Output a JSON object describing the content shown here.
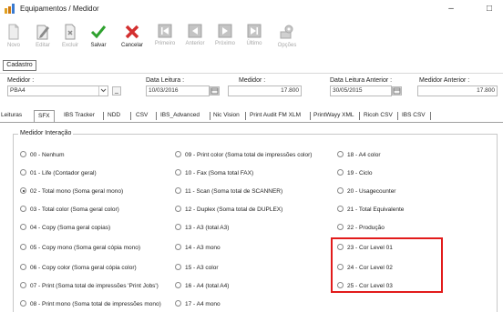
{
  "window": {
    "title": "Equipamentos / Medidor",
    "minimize": "–",
    "maximize": "□"
  },
  "toolbar": {
    "items": [
      {
        "label": "Novo",
        "icon": "new-doc-icon",
        "enabled": false
      },
      {
        "label": "Editar",
        "icon": "edit-icon",
        "enabled": false
      },
      {
        "label": "Excluir",
        "icon": "delete-icon",
        "enabled": false
      },
      {
        "label": "Salvar",
        "icon": "save-check-icon",
        "enabled": true
      },
      {
        "label": "Cancelar",
        "icon": "cancel-x-icon",
        "enabled": true
      },
      {
        "label": "Primeiro",
        "icon": "first-icon",
        "enabled": false
      },
      {
        "label": "Anterior",
        "icon": "previous-icon",
        "enabled": false
      },
      {
        "label": "Próximo",
        "icon": "next-icon",
        "enabled": false
      },
      {
        "label": "Último",
        "icon": "last-icon",
        "enabled": false
      },
      {
        "label": "Opções",
        "icon": "options-icon",
        "enabled": false
      }
    ],
    "colors": {
      "save": "#2ea12e",
      "cancel": "#d32f2f",
      "disabled": "#a8a8a8"
    }
  },
  "cadastro_tab": "Cadastro",
  "form": {
    "medidor_label": "Medidor :",
    "medidor_value": "PBA4",
    "data_leitura_label": "Data Leitura :",
    "data_leitura_value": "10/03/2016",
    "medidor2_label": "Medidor :",
    "medidor2_value": "17.800",
    "data_leitura_anterior_label": "Data Leitura Anterior :",
    "data_leitura_anterior_value": "30/05/2015",
    "medidor_anterior_label": "Medidor Anterior :",
    "medidor_anterior_value": "17.800"
  },
  "tabs": [
    "Leituras",
    "SFX",
    "IBS Tracker",
    "NDD",
    "CSV",
    "IBS_Advanced",
    "Nic Vision",
    "Print Audit FM XLM",
    "PrintWayy XML",
    "Ricoh CSV",
    "IBS CSV"
  ],
  "active_tab": "SFX",
  "group": {
    "title": "Medidor Interação",
    "col1": [
      "00 - Nenhum",
      "01 - Life (Contador geral)",
      "02 - Total mono (Soma geral mono)",
      "03 - Total color (Soma geral color)",
      "04 - Copy (Soma geral copias)",
      "05 - Copy mono (Soma geral cópia mono)",
      "06 - Copy color (Soma geral cópia color)",
      "07 - Print (Soma total de impressões 'Print Jobs')",
      "08 - Print mono (Soma total de impressões mono)"
    ],
    "col2": [
      "09 - Print color (Soma total de impressões color)",
      "10 - Fax (Soma total FAX)",
      "11 - Scan (Soma total de SCANNER)",
      "12 - Duplex (Soma total de DUPLEX)",
      "13 - A3 (total A3)",
      "14 - A3 mono",
      "15 - A3 color",
      "16 - A4 (total A4)",
      "17 - A4 mono"
    ],
    "col3": [
      "18 - A4 color",
      "19 - Ciclo",
      "20 - Usagecounter",
      "21 - Total Equivalente",
      "22 - Produção",
      "23 - Cor Level 01",
      "24 - Cor Level 02",
      "25 - Cor Level 03"
    ],
    "selected": "02 - Total mono (Soma geral mono)"
  },
  "highlight_color": "#e21b1b"
}
